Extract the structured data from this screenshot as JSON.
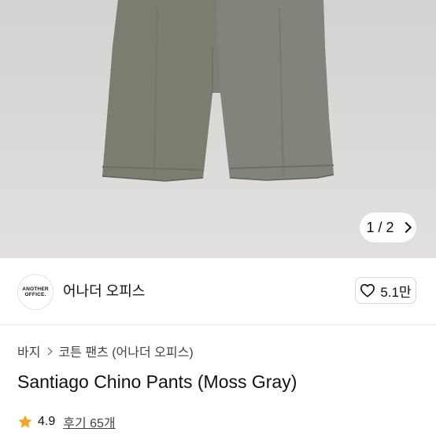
{
  "gallery": {
    "current": 1,
    "total": 2,
    "pager_text": "1 / 2"
  },
  "brand": {
    "logo_line1": "ANOTHER",
    "logo_line2": "OFFICE.",
    "name": "어나더 오피스"
  },
  "like": {
    "count": "5.1만",
    "icon": "heart-outline-icon"
  },
  "breadcrumb": {
    "level1": "바지",
    "level2": "코튼 팬츠 (어나더 오피스)"
  },
  "product": {
    "title": "Santiago Chino Pants (Moss Gray)"
  },
  "rating": {
    "score": "4.9",
    "review_label": "후기 65개",
    "star_color": "#f5a623",
    "icon": "star-icon"
  }
}
